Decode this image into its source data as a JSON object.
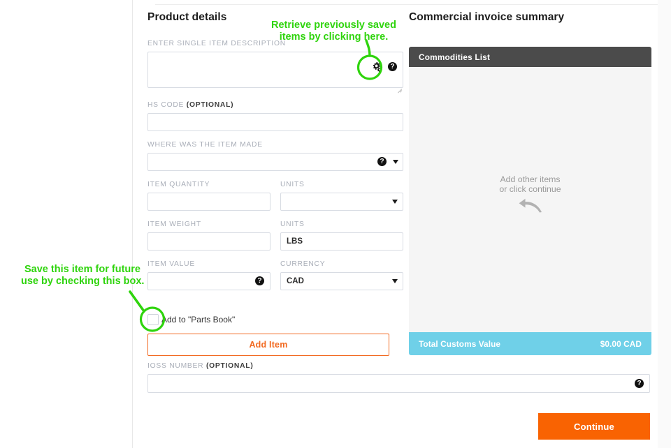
{
  "left_column": {
    "title": "Product details",
    "fields": {
      "description": {
        "label": "ENTER SINGLE ITEM DESCRIPTION",
        "value": "",
        "placeholder": "",
        "gear_icon": "gear-icon",
        "help_icon": "help-icon"
      },
      "hs_code": {
        "label_main": "HS CODE ",
        "label_bold": "(OPTIONAL)",
        "value": ""
      },
      "origin": {
        "label": "WHERE WAS THE ITEM MADE",
        "value": "",
        "help_icon": "help-icon",
        "caret_icon": "chevron-down-icon"
      },
      "item_quantity": {
        "label": "ITEM QUANTITY",
        "value": ""
      },
      "quantity_units": {
        "label": "UNITS",
        "value": "",
        "caret_icon": "chevron-down-icon"
      },
      "item_weight": {
        "label": "ITEM WEIGHT",
        "value": ""
      },
      "weight_units": {
        "label": "UNITS",
        "value": "LBS"
      },
      "item_value": {
        "label": "ITEM VALUE",
        "value": "",
        "help_icon": "help-icon"
      },
      "currency": {
        "label": "CURRENCY",
        "value": "CAD",
        "caret_icon": "chevron-down-icon"
      },
      "ioss": {
        "label_main": "IOSS NUMBER ",
        "label_bold": "(OPTIONAL)",
        "value": "",
        "help_icon": "help-icon"
      }
    },
    "parts_book_checkbox": {
      "label": "Add to \"Parts Book\"",
      "checked": false
    },
    "add_item_button": "Add Item",
    "continue_button": "Continue"
  },
  "right_column": {
    "title": "Commercial invoice summary",
    "panel_header": "Commodities List",
    "empty_state_line1": "Add other items",
    "empty_state_line2": "or click continue",
    "empty_state_icon": "curved-left-arrow-icon",
    "total_label": "Total Customs Value",
    "total_value": "$0.00 CAD"
  },
  "annotations": {
    "top": "Retrieve previously saved\nitems by clicking here.",
    "left": "Save this item for future\nuse by checking this box.",
    "color": "#2fd40d"
  },
  "colors": {
    "accent_orange": "#f96302",
    "add_item_orange": "#f26a21",
    "total_bar_teal": "#6fd0e8",
    "panel_header_gray": "#4b4b4b",
    "panel_body_gray": "#f5f5f5",
    "label_gray": "#a9aeb8",
    "annotation_green": "#2fd40d"
  }
}
